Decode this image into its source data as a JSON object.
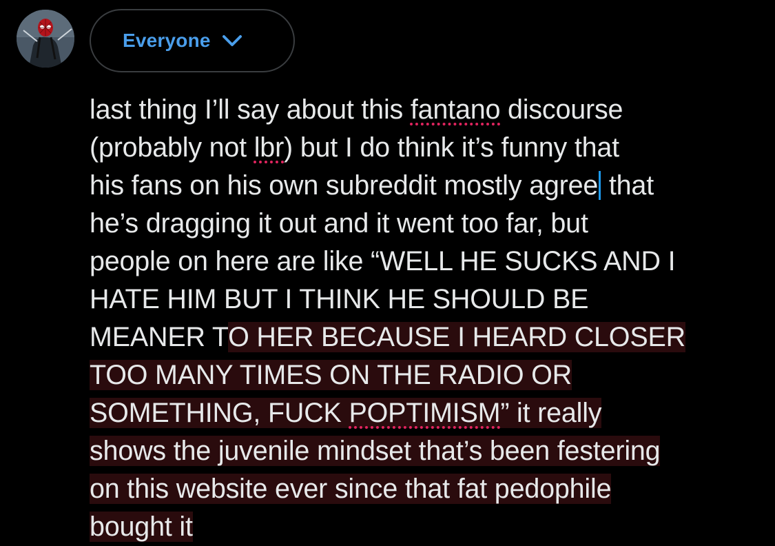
{
  "audience": {
    "label": "Everyone"
  },
  "icons": {
    "dropdown": "chevron-down-icon",
    "avatar": "spiderman-avatar"
  },
  "colors": {
    "accent": "#4a9eeb",
    "caret": "#1d9bf0",
    "text": "#e7e9ea",
    "overflow_highlight": "#2a0b0d",
    "spellcheck_underline": "#e0245e"
  },
  "compose": {
    "segments": {
      "s01": "last thing I’ll say about this ",
      "s02": "fantano",
      "s03": " discourse\n(probably not ",
      "s04": "lbr",
      "s05": ") but I do think it’s funny that\nhis fans on his own subreddit mostly agree",
      "s06": " that\nhe’s dragging it out and it went too far, but\npeople on here are like “WELL HE SUCKS AND I\nHATE HIM BUT I THINK HE SHOULD BE\nMEANER T",
      "s07": "O HER BECAUSE I HEARD CLOSER\nTOO MANY TIMES ON THE RADIO OR\nSOMETHING, FUCK ",
      "s08": "POPTIMISM",
      "s09": "” it really\nshows the juvenile mindset that’s been festering\non this website ever since that fat pedophile\nbought it"
    }
  }
}
